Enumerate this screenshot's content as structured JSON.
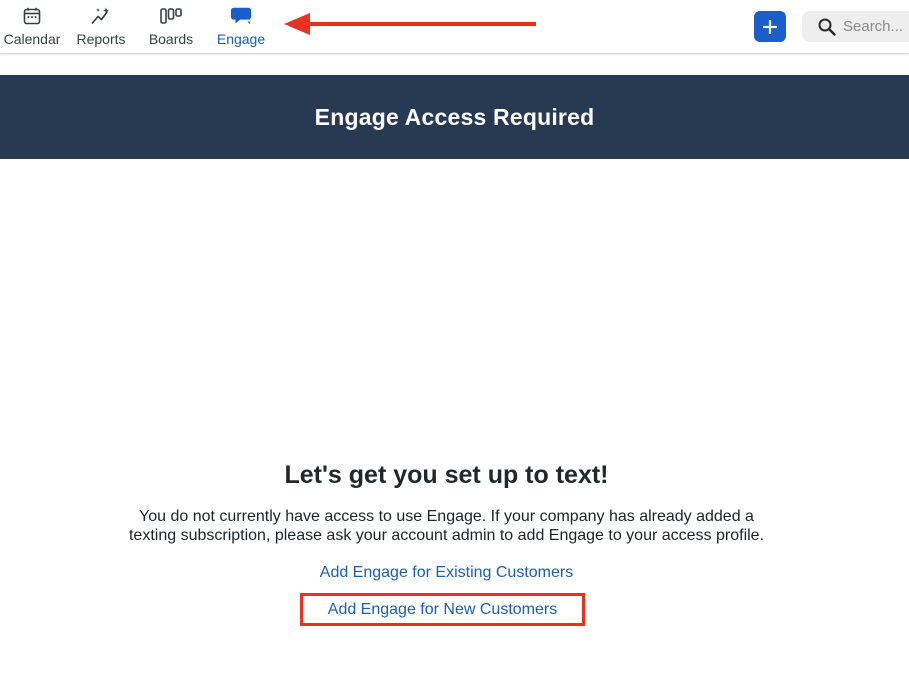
{
  "nav": {
    "items": [
      {
        "label": "Calendar",
        "icon": "calendar-icon"
      },
      {
        "label": "Reports",
        "icon": "sparkle-chart-icon"
      },
      {
        "label": "Boards",
        "icon": "boards-icon"
      },
      {
        "label": "Engage",
        "icon": "chat-bubbles-icon",
        "active": true
      }
    ]
  },
  "search": {
    "placeholder": "Search..."
  },
  "banner": {
    "title": "Engage Access Required"
  },
  "main": {
    "heading": "Let's get you set up to text!",
    "description": "You do not currently have access to use Engage. If your company has already added a texting subscription, please ask your account admin to add Engage to your access profile.",
    "link_existing": "Add Engage for Existing Customers",
    "link_new": "Add Engage for New Customers"
  },
  "colors": {
    "banner_bg": "#283a52",
    "accent_blue": "#1a5fc9",
    "link_blue": "#1a5fb4",
    "annotation_red": "#e8321f"
  }
}
